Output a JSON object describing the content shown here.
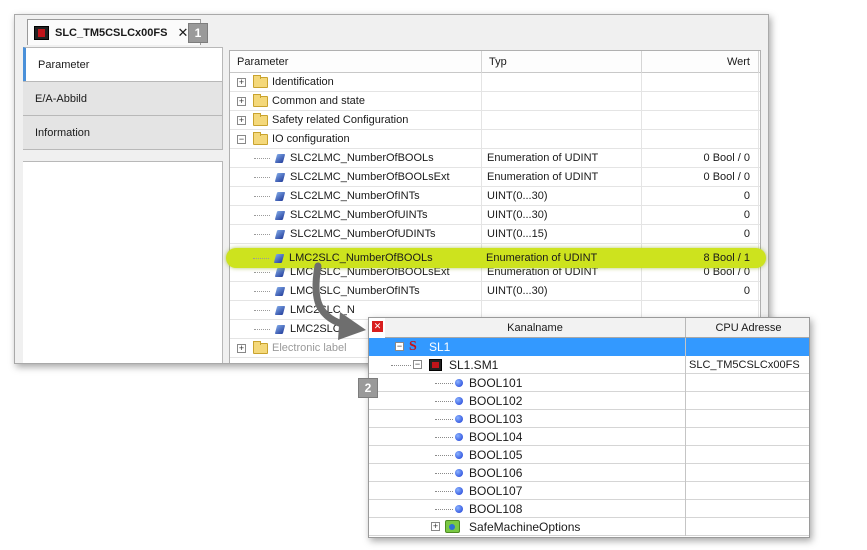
{
  "editor": {
    "tab_title": "SLC_TM5CSLCx00FS",
    "tab_close": "✕",
    "badge": "1",
    "side_tabs": [
      "Parameter",
      "E/A-Abbild",
      "Information"
    ],
    "columns": {
      "parameter": "Parameter",
      "typ": "Typ",
      "wert": "Wert"
    },
    "rows": [
      {
        "name": "Identification",
        "type": "",
        "value": "",
        "kind": "folder"
      },
      {
        "name": "Common and state",
        "type": "",
        "value": "",
        "kind": "folder"
      },
      {
        "name": "Safety related Configuration",
        "type": "",
        "value": "",
        "kind": "folder"
      },
      {
        "name": "IO configuration",
        "type": "",
        "value": "",
        "kind": "folder-open"
      },
      {
        "name": "SLC2LMC_NumberOfBOOLs",
        "type": "Enumeration of UDINT",
        "value": "0 Bool / 0",
        "kind": "param"
      },
      {
        "name": "SLC2LMC_NumberOfBOOLsExt",
        "type": "Enumeration of UDINT",
        "value": "0 Bool / 0",
        "kind": "param"
      },
      {
        "name": "SLC2LMC_NumberOfINTs",
        "type": "UINT(0...30)",
        "value": "0",
        "kind": "param"
      },
      {
        "name": "SLC2LMC_NumberOfUINTs",
        "type": "UINT(0...30)",
        "value": "0",
        "kind": "param"
      },
      {
        "name": "SLC2LMC_NumberOfUDINTs",
        "type": "UINT(0...15)",
        "value": "0",
        "kind": "param"
      },
      {
        "name": "LMC2SLC_NumberOfBOOLs",
        "type": "Enumeration of UDINT",
        "value": "8 Bool / 1",
        "kind": "param",
        "highlight": true
      },
      {
        "name": "LMC2SLC_NumberOfBOOLsExt",
        "type": "Enumeration of UDINT",
        "value": "0 Bool / 0",
        "kind": "param"
      },
      {
        "name": "LMC2SLC_NumberOfINTs",
        "type": "UINT(0...30)",
        "value": "0",
        "kind": "param"
      },
      {
        "name": "LMC2SLC_N",
        "type": "",
        "value": "",
        "kind": "param"
      },
      {
        "name": "LMC2SLC_N",
        "type": "",
        "value": "",
        "kind": "param"
      },
      {
        "name": "Electronic label",
        "type": "",
        "value": "",
        "kind": "folder",
        "faded": true
      }
    ]
  },
  "channel_window": {
    "badge": "2",
    "close": "✕",
    "columns": {
      "name": "Kanalname",
      "cpu": "CPU Adresse"
    },
    "rows": [
      {
        "name": "SL1",
        "cpu": "",
        "kind": "root",
        "selected": true
      },
      {
        "name": "SL1.SM1",
        "cpu": "SLC_TM5CSLCx00FS",
        "kind": "module"
      },
      {
        "name": "BOOL101",
        "cpu": "",
        "kind": "bool"
      },
      {
        "name": "BOOL102",
        "cpu": "",
        "kind": "bool"
      },
      {
        "name": "BOOL103",
        "cpu": "",
        "kind": "bool"
      },
      {
        "name": "BOOL104",
        "cpu": "",
        "kind": "bool"
      },
      {
        "name": "BOOL105",
        "cpu": "",
        "kind": "bool"
      },
      {
        "name": "BOOL106",
        "cpu": "",
        "kind": "bool"
      },
      {
        "name": "BOOL107",
        "cpu": "",
        "kind": "bool"
      },
      {
        "name": "BOOL108",
        "cpu": "",
        "kind": "bool"
      },
      {
        "name": "SafeMachineOptions",
        "cpu": "",
        "kind": "options"
      }
    ]
  },
  "colors": {
    "highlight": "#cde31e",
    "selection": "#3399ff",
    "arrow": "#6e6e6e",
    "side_tab_accent": "#4a90d9"
  }
}
